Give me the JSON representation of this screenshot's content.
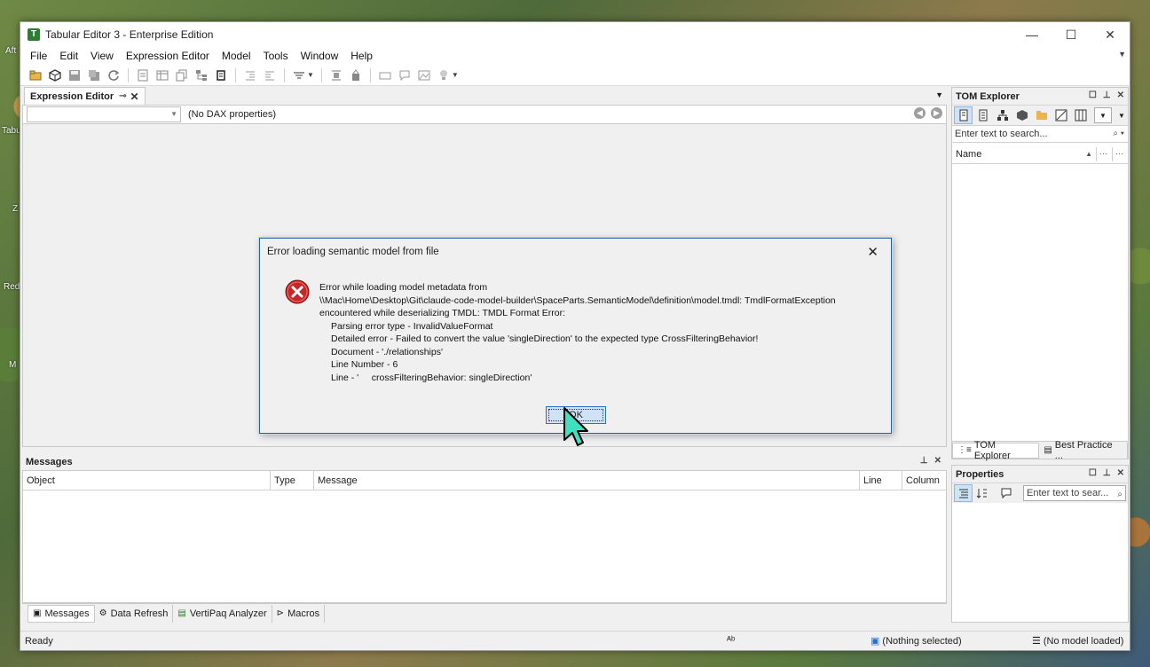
{
  "desktop": {
    "labels": [
      "Aft",
      "Tabu",
      "Z",
      "Red",
      "M"
    ]
  },
  "window": {
    "title": "Tabular Editor 3 - Enterprise Edition",
    "icon": "T",
    "controls": {
      "minimize": "—",
      "maximize": "☐",
      "close": "✕"
    }
  },
  "menu": {
    "items": [
      "File",
      "Edit",
      "View",
      "Expression Editor",
      "Model",
      "Tools",
      "Window",
      "Help"
    ]
  },
  "expression_editor": {
    "tab_label": "Expression Editor",
    "combo_value": "",
    "dax_label": "(No DAX properties)"
  },
  "tom_explorer": {
    "title": "TOM Explorer",
    "search_placeholder": "Enter text to search...",
    "column_name": "Name",
    "bottom_tabs": [
      "TOM Explorer",
      "Best Practice ..."
    ]
  },
  "properties": {
    "title": "Properties",
    "search_placeholder": "Enter text to sear..."
  },
  "messages": {
    "title": "Messages",
    "columns": [
      "Object",
      "Type",
      "Message",
      "Line",
      "Column"
    ],
    "tabs": [
      "Messages",
      "Data Refresh",
      "VertiPaq Analyzer",
      "Macros"
    ]
  },
  "status": {
    "left": "Ready",
    "selection": "(Nothing selected)",
    "model": "(No model loaded)"
  },
  "dialog": {
    "title": "Error loading semantic model from file",
    "lines": [
      "Error while loading model metadata from",
      "\\\\Mac\\Home\\Desktop\\Git\\claude-code-model-builder\\SpaceParts.SemanticModel\\definition\\model.tmdl: TmdlFormatException",
      "encountered while deserializing TMDL: TMDL Format Error:"
    ],
    "details": [
      "Parsing error type - InvalidValueFormat",
      "Detailed error - Failed to convert the value 'singleDirection' to the expected type CrossFilteringBehavior!",
      "Document - './relationships'",
      "Line Number - 6",
      "Line - '     crossFilteringBehavior: singleDirection'"
    ],
    "ok_label": "OK",
    "icon": "error-icon"
  },
  "colors": {
    "error_red": "#c62828",
    "dialog_border": "#1f5fa8",
    "ok_fill": "#cfe2f7",
    "cursor_fill": "#3fe0c0"
  }
}
